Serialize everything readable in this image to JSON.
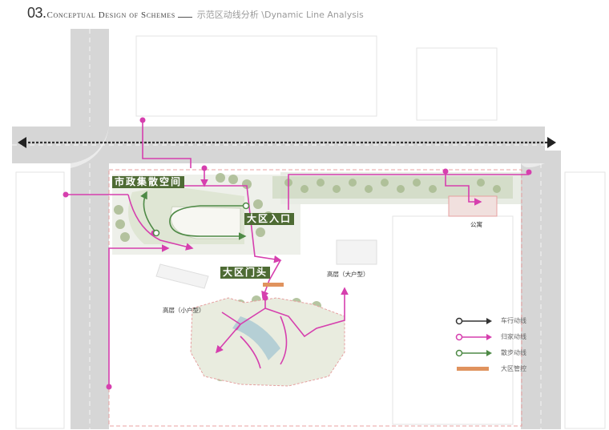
{
  "header": {
    "number": "03.",
    "title": "Conceptual Design of Schemes",
    "subtitle": "示范区动线分析 \\Dynamic Line Analysis"
  },
  "map_labels": {
    "municipal_space": "市政集散空间",
    "main_entrance": "大区入口",
    "gate": "大区门头",
    "apartment": "公寓",
    "high_rise_large": "高层（大户型）",
    "high_rise_small": "高层（小户型）"
  },
  "legend": [
    {
      "icon": "dark-circle-arrow",
      "color": "#333333",
      "label": "车行动线"
    },
    {
      "icon": "magenta-circle-arrow",
      "color": "#d63fae",
      "label": "归家动线"
    },
    {
      "icon": "green-circle-arrow",
      "color": "#4e8a46",
      "label": "散步动线"
    },
    {
      "icon": "orange-bar",
      "color": "#e0935e",
      "label": "大区管控"
    }
  ],
  "colors": {
    "vehicle": "#333333",
    "homecoming": "#d63fae",
    "walk": "#4e8a46",
    "control": "#e0935e",
    "label_bg": "#4e6b34"
  }
}
